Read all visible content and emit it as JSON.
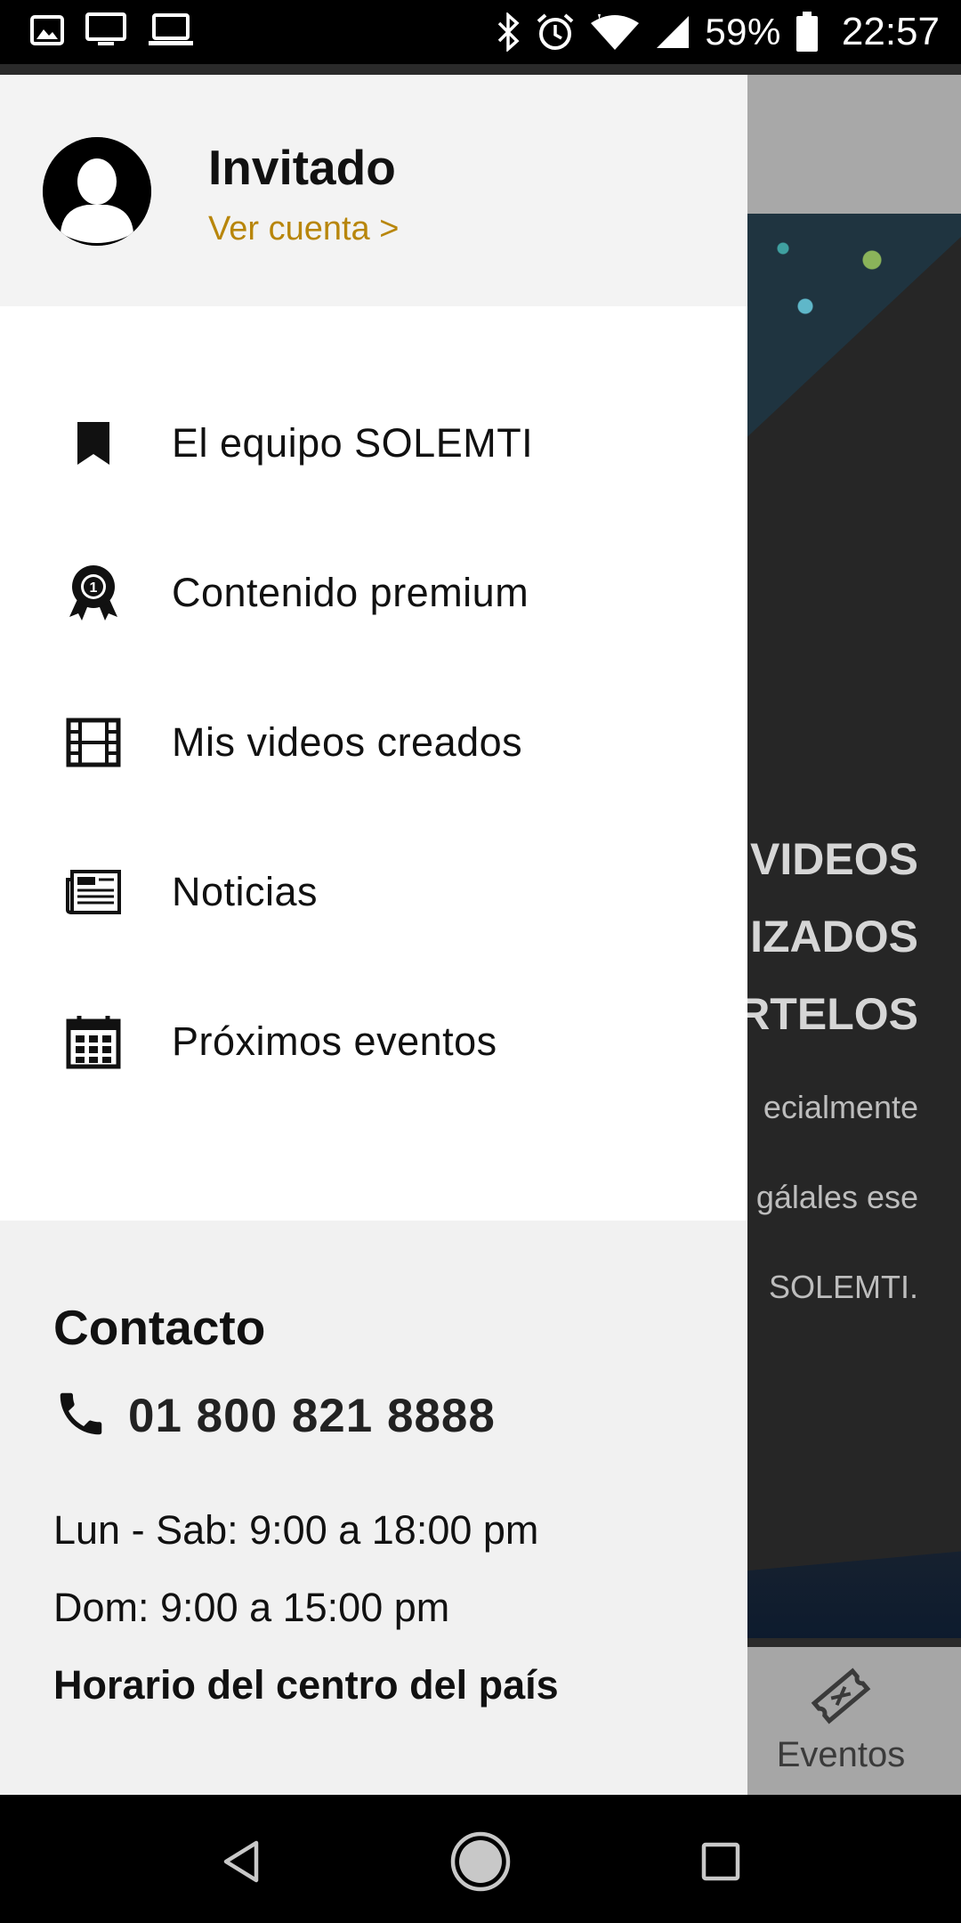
{
  "status_bar": {
    "battery_percent": "59%",
    "time": "22:57",
    "icons": [
      "image-icon",
      "monitor-icon",
      "laptop-icon",
      "bluetooth-icon",
      "alarm-icon",
      "wifi-icon",
      "signal-icon",
      "battery-icon"
    ]
  },
  "drawer": {
    "user_name": "Invitado",
    "account_link": "Ver cuenta >",
    "menu": [
      {
        "label": "El equipo SOLEMTI",
        "icon": "bookmark-icon"
      },
      {
        "label": "Contenido premium",
        "icon": "award-icon"
      },
      {
        "label": "Mis videos creados",
        "icon": "film-icon"
      },
      {
        "label": "Noticias",
        "icon": "news-icon"
      },
      {
        "label": "Próximos eventos",
        "icon": "calendar-icon"
      }
    ],
    "contact": {
      "title": "Contacto",
      "phone": "01 800 821 8888",
      "hours_weekday": "Lun - Sab: 9:00 a 18:00 pm",
      "hours_sunday": "Dom: 9:00 a 15:00 pm",
      "timezone": "Horario del centro del país"
    }
  },
  "background": {
    "headline_lines": [
      "VIDEOS",
      "IZADOS",
      "RTELOS"
    ],
    "desc_lines": [
      "ecialmente",
      "gálales ese",
      "SOLEMTI."
    ],
    "nav_label": "Eventos"
  },
  "colors": {
    "accent": "#b8860b",
    "header_bg": "#f3f3f3",
    "contact_bg": "#f1f1f1"
  }
}
